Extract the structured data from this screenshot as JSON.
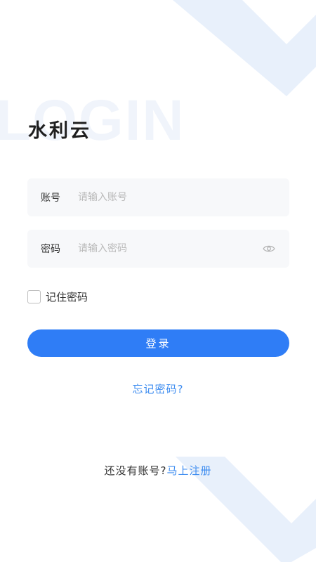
{
  "brand": {
    "watermark": "LOGIN",
    "app_title": "水利云"
  },
  "form": {
    "account": {
      "label": "账号",
      "placeholder": "请输入账号",
      "value": ""
    },
    "password": {
      "label": "密码",
      "placeholder": "请输入密码",
      "value": "",
      "toggle_icon": "eye-icon"
    },
    "remember": {
      "label": "记住密码",
      "checked": false
    },
    "login_label": "登录",
    "forgot_label": "忘记密码?"
  },
  "register": {
    "prompt": "还没有账号?",
    "link_label": "马上注册"
  },
  "colors": {
    "primary": "#2f7df6",
    "link": "#3d8cf0",
    "field_bg": "#f7f8fa",
    "decor": "#e3edfb"
  }
}
